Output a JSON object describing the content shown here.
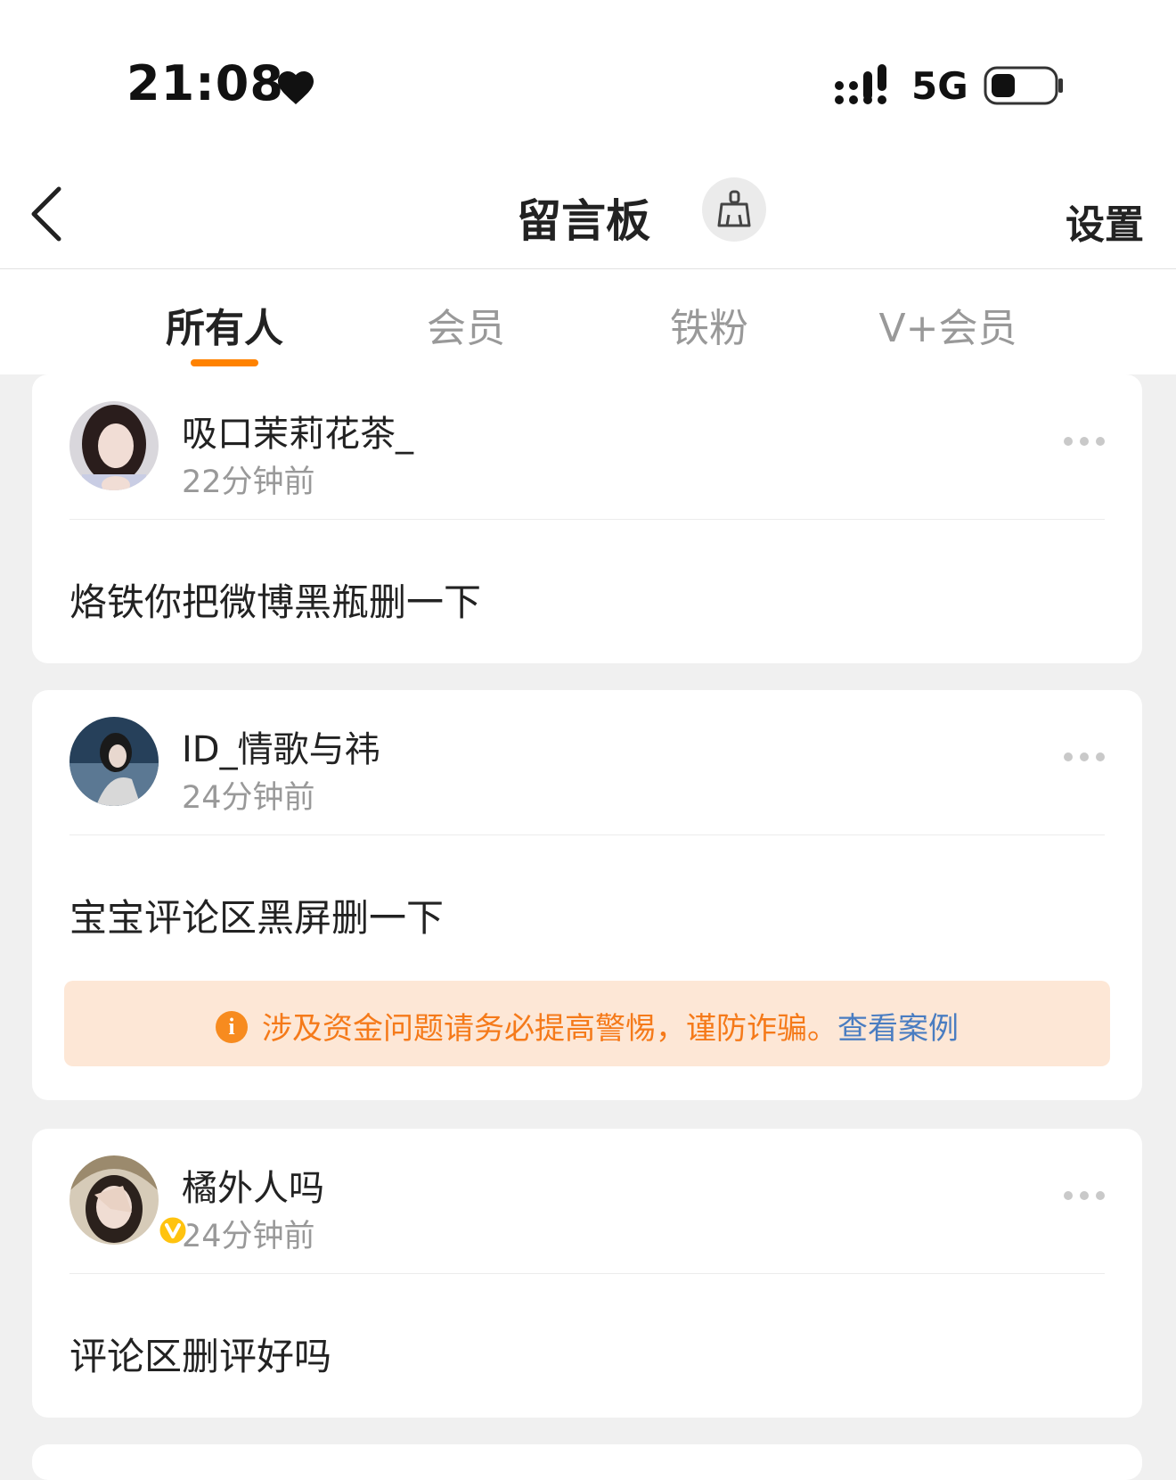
{
  "status_bar": {
    "time": "21:08",
    "network": "5G"
  },
  "nav": {
    "title": "留言板",
    "settings_label": "设置"
  },
  "tabs": [
    {
      "label": "所有人",
      "active": true
    },
    {
      "label": "会员",
      "active": false
    },
    {
      "label": "铁粉",
      "active": false
    },
    {
      "label": "V+会员",
      "active": false
    }
  ],
  "posts": [
    {
      "username": "吸口茉莉花茶_",
      "time": "22分钟前",
      "message": "烙铁你把微博黑瓶删一下"
    },
    {
      "username": "ID_情歌与祎",
      "time": "24分钟前",
      "message": "宝宝评论区黑屏删一下",
      "warning": {
        "text": "涉及资金问题请务必提高警惕，谨防诈骗。",
        "link": "查看案例"
      }
    },
    {
      "username": "橘外人吗",
      "time": "24分钟前",
      "message": "评论区删评好吗",
      "verified": true
    }
  ],
  "colors": {
    "accent": "#ff8200",
    "warning_bg": "#fde7d6",
    "warning_text": "#f57a1a",
    "link": "#4a7dc1",
    "verified_badge": "#ffc30f"
  },
  "icons": [
    "heart-icon",
    "signal-icon",
    "battery-icon",
    "back-arrow-icon",
    "broom-icon",
    "more-icon",
    "info-icon",
    "verified-badge-icon"
  ]
}
